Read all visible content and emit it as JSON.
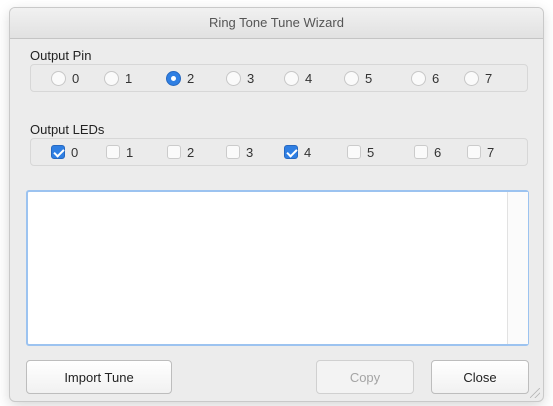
{
  "window": {
    "title": "Ring Tone Tune Wizard"
  },
  "output_pin": {
    "label": "Output Pin",
    "options": [
      "0",
      "1",
      "2",
      "3",
      "4",
      "5",
      "6",
      "7"
    ],
    "selected": "2"
  },
  "output_leds": {
    "label": "Output LEDs",
    "options": [
      "0",
      "1",
      "2",
      "3",
      "4",
      "5",
      "6",
      "7"
    ],
    "checked": [
      "0",
      "4"
    ]
  },
  "tune_text": {
    "value": ""
  },
  "buttons": {
    "import": "Import Tune",
    "copy": "Copy",
    "close": "Close"
  },
  "colors": {
    "accent": "#2f7fe3",
    "focus_ring": "#9cc3f0"
  }
}
